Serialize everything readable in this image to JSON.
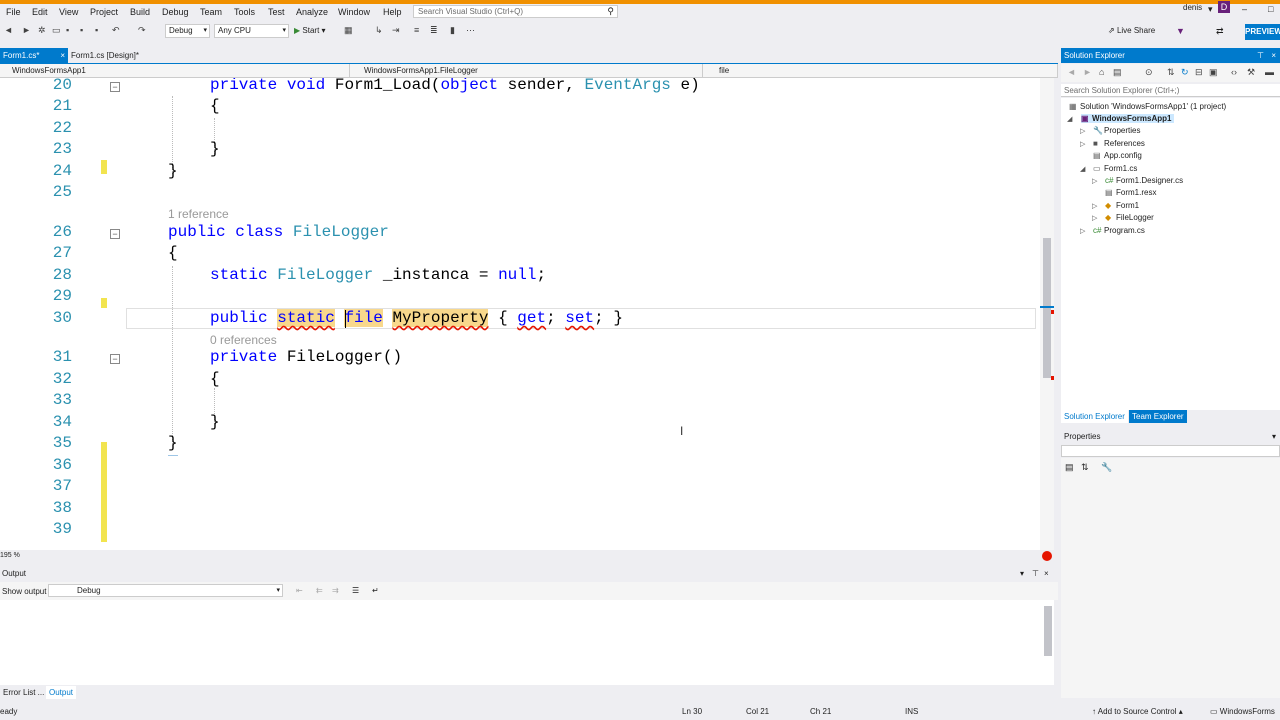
{
  "menu": {
    "items": [
      "File",
      "Edit",
      "View",
      "Project",
      "Build",
      "Debug",
      "Team",
      "Tools",
      "Test",
      "Analyze",
      "Window",
      "Help"
    ],
    "search_placeholder": "Search Visual Studio (Ctrl+Q)",
    "user": "denis",
    "avatar_letter": "D"
  },
  "toolbar": {
    "config": "Debug",
    "platform": "Any CPU",
    "start_label": "Start",
    "live_share": "Live Share",
    "preview": "PREVIEW"
  },
  "tabs": [
    {
      "label": "Form1.cs*",
      "active": true
    },
    {
      "label": "Form1.cs [Design]*",
      "active": false
    }
  ],
  "navbar": {
    "project": "WindowsFormsApp1",
    "type": "WindowsFormsApp1.FileLogger",
    "member": "file"
  },
  "editor": {
    "lens": {
      "one_reference": "1 reference",
      "zero_references": "0 references"
    },
    "lines": [
      {
        "n": "20",
        "code": "private void Form1_Load(object sender, EventArgs e)"
      },
      {
        "n": "21",
        "code": "{"
      },
      {
        "n": "22",
        "code": ""
      },
      {
        "n": "23",
        "code": "}"
      },
      {
        "n": "24",
        "code": "}"
      },
      {
        "n": "25",
        "code": ""
      },
      {
        "n": "26",
        "code": "public class FileLogger"
      },
      {
        "n": "27",
        "code": "{"
      },
      {
        "n": "28",
        "code": "static FileLogger _instanca = null;"
      },
      {
        "n": "29",
        "code": ""
      },
      {
        "n": "30",
        "code": "public static file MyProperty { get; set; }"
      },
      {
        "n": "31",
        "code": "private FileLogger()"
      },
      {
        "n": "32",
        "code": "{"
      },
      {
        "n": "33",
        "code": ""
      },
      {
        "n": "34",
        "code": "}"
      },
      {
        "n": "35",
        "code": "}"
      },
      {
        "n": "36",
        "code": ""
      },
      {
        "n": "37",
        "code": ""
      },
      {
        "n": "38",
        "code": ""
      },
      {
        "n": "39",
        "code": ""
      }
    ],
    "zoom": "195 %"
  },
  "output": {
    "title": "Output",
    "show_from_label": "Show output from:",
    "source": "Debug"
  },
  "bottom_tabs": [
    "Error List ...",
    "Output"
  ],
  "status": {
    "left": "eady",
    "ln": "Ln 30",
    "col": "Col 21",
    "ch": "Ch 21",
    "ins": "INS",
    "source_control": "Add to Source Control",
    "project": "WindowsForms"
  },
  "solution_explorer": {
    "title": "Solution Explorer",
    "search_placeholder": "Search Solution Explorer (Ctrl+;)",
    "nodes": [
      {
        "label": "Solution 'WindowsFormsApp1' (1 project)",
        "icon": "solution-icon"
      },
      {
        "label": "WindowsFormsApp1",
        "icon": "csproj-icon"
      },
      {
        "label": "Properties",
        "icon": "wrench-icon"
      },
      {
        "label": "References",
        "icon": "references-icon"
      },
      {
        "label": "App.config",
        "icon": "config-file-icon"
      },
      {
        "label": "Form1.cs",
        "icon": "form-icon"
      },
      {
        "label": "Form1.Designer.cs",
        "icon": "cs-file-icon"
      },
      {
        "label": "Form1.resx",
        "icon": "resx-icon"
      },
      {
        "label": "Form1",
        "icon": "class-icon"
      },
      {
        "label": "FileLogger",
        "icon": "class-icon"
      },
      {
        "label": "Program.cs",
        "icon": "cs-file-icon"
      }
    ],
    "tabs": [
      "Solution Explorer",
      "Team Explorer"
    ]
  },
  "properties": {
    "title": "Properties"
  },
  "colors": {
    "accent": "#007acc",
    "keyword": "#0000ff",
    "type": "#2b91af",
    "highlight": "#f8d88c",
    "error": "#e51400",
    "title_strip": "#f09000"
  }
}
